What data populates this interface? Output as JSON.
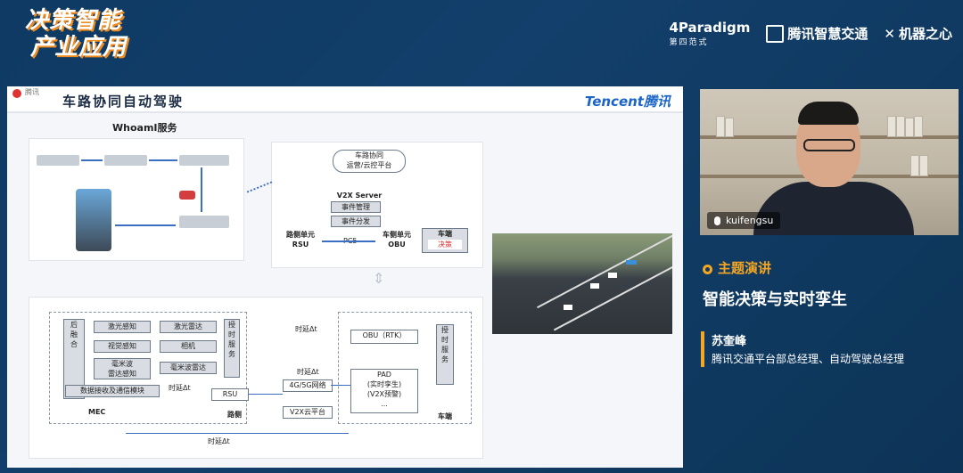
{
  "header": {
    "brand_line1": "决策智能",
    "brand_line2": "产业应用",
    "logos": {
      "paradigm_name": "4Paradigm",
      "paradigm_sub": "第四范式",
      "tencent_transport": "腾讯智慧交通",
      "jiqizhixin": "机器之心"
    }
  },
  "slide": {
    "chip": "腾讯",
    "title": "车路协同自动驾驶",
    "logo_en": "Tencent",
    "logo_cn": "腾讯",
    "whoami_title": "WhoamI服务",
    "platform": {
      "cloud": "车路协同\n运营/云控平台",
      "server": "V2X Server",
      "event_mgmt": "事件管理",
      "event_dist": "事件分发",
      "rsu": "路侧单元\nRSU",
      "pc5": "PC5",
      "obu": "车侧单元\nOBU",
      "vehicle": "车端",
      "decision": "决策"
    },
    "arch": {
      "fusion": "后\n融\n合",
      "lidar_perc": "激光感知",
      "visual_perc": "视觉感知",
      "mmwave_perc": "毫米波\n雷达感知",
      "lidar": "激光雷达",
      "camera": "相机",
      "mmwave": "毫米波雷达",
      "timing_service": "授\n时\n服\n务",
      "data_module": "数据接收及通信模块",
      "mec": "MEC",
      "delay1": "时延Δt",
      "delay2": "时延Δt",
      "delay3": "时延Δt",
      "delay4": "时延Δt",
      "rsu": "RSU",
      "roadside": "路侧",
      "network": "4G/5G网络",
      "v2x_cloud": "V2X云平台",
      "obu_rtk": "OBU（RTK）",
      "pad": "PAD\n(实时孪生)\n(V2X预警)\n...",
      "vehicle_side": "车端",
      "timing_service2": "授\n时\n服\n务"
    }
  },
  "webcam": {
    "username": "kuifengsu"
  },
  "info": {
    "topic_label": "主题演讲",
    "talk_title": "智能决策与实时孪生",
    "speaker_name": "苏奎峰",
    "speaker_role": "腾讯交通平台部总经理、自动驾驶总经理"
  },
  "colors": {
    "accent": "#f5a623",
    "background": "#0e3a63",
    "tencent_blue": "#1b64c8"
  }
}
